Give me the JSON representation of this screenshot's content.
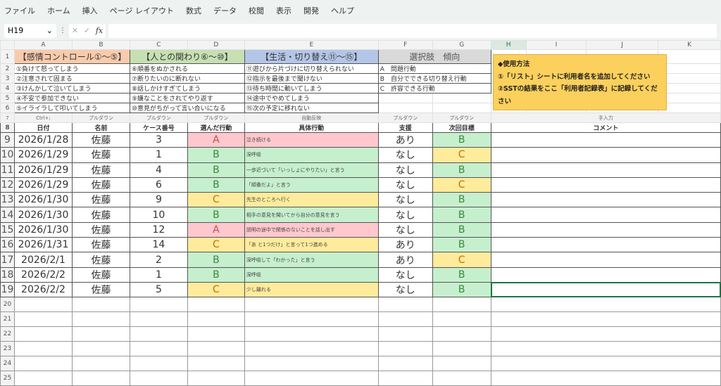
{
  "menu": [
    "ファイル",
    "ホーム",
    "挿入",
    "ページ レイアウト",
    "数式",
    "データ",
    "校閲",
    "表示",
    "開発",
    "ヘルプ"
  ],
  "formula_bar": {
    "name_box": "H19",
    "fx": "fx",
    "value": ""
  },
  "columns": [
    "A",
    "B",
    "C",
    "D",
    "E",
    "F",
    "G",
    "H",
    "I",
    "J",
    "K"
  ],
  "headers": {
    "a": "【感情コントロール①～⑤】",
    "c": "【人との関わり⑥～⑩】",
    "e": "【生活・切り替え⑪～⑮】",
    "f": "選択肢　傾向"
  },
  "list_a": [
    "①負けて怒ってしまう",
    "②注意されて固まる",
    "③けんかして泣いてしまう",
    "④不安で参加できない",
    "⑤イライラして叩いてしまう"
  ],
  "list_c": [
    "⑥順番をぬかされる",
    "⑦断りたいのに断れない",
    "⑧話しかけすぎてしまう",
    "⑨嫌なことをされてやり返す",
    "⑩意見がちがって言い合いになる"
  ],
  "list_e": [
    "⑪遊びから片づけに切り替えられない",
    "⑫指示を最後まで聞けない",
    "⑬待ち時間に動いてしまう",
    "⑭途中でやめてしまう",
    "⑮次の予定に移れない"
  ],
  "list_f": [
    "A　問題行動",
    "B　自分でできる切り替え行動",
    "C　許容できる行動"
  ],
  "row7": {
    "a": "Ctrl+;",
    "b": "プルダウン",
    "c": "プルダウン",
    "d": "プルダウン",
    "e": "自動反映",
    "f": "プルダウン",
    "g": "プルダウン",
    "hk": "手入力"
  },
  "row8": {
    "a": "日付",
    "b": "名前",
    "c": "ケース番号",
    "d": "選んだ行動",
    "e": "具体行動",
    "f": "支援",
    "g": "次回目標",
    "hk": "コメント"
  },
  "records": [
    {
      "date": "2026/1/28",
      "name": "佐藤",
      "case": "3",
      "action": "A",
      "detail": "泣き続ける",
      "support": "あり",
      "goal": "B"
    },
    {
      "date": "2026/1/29",
      "name": "佐藤",
      "case": "1",
      "action": "B",
      "detail": "深呼吸",
      "support": "なし",
      "goal": "C"
    },
    {
      "date": "2026/1/29",
      "name": "佐藤",
      "case": "4",
      "action": "B",
      "detail": "一歩近づいて「いっしょにやりたい」と言う",
      "support": "なし",
      "goal": "B"
    },
    {
      "date": "2026/1/29",
      "name": "佐藤",
      "case": "6",
      "action": "B",
      "detail": "「順番だよ」と言う",
      "support": "なし",
      "goal": "C"
    },
    {
      "date": "2026/1/30",
      "name": "佐藤",
      "case": "9",
      "action": "C",
      "detail": "先生のところへ行く",
      "support": "なし",
      "goal": "B"
    },
    {
      "date": "2026/1/30",
      "name": "佐藤",
      "case": "10",
      "action": "B",
      "detail": "相手の意見を聞いてから自分の意見を言う",
      "support": "なし",
      "goal": "B"
    },
    {
      "date": "2026/1/30",
      "name": "佐藤",
      "case": "12",
      "action": "A",
      "detail": "説明の途中で関係のないことを話し出す",
      "support": "なし",
      "goal": "B"
    },
    {
      "date": "2026/1/31",
      "name": "佐藤",
      "case": "14",
      "action": "C",
      "detail": "「あ と1つだけ」と言って1つ進める",
      "support": "あり",
      "goal": "B"
    },
    {
      "date": "2026/2/1",
      "name": "佐藤",
      "case": "2",
      "action": "B",
      "detail": "深呼吸して「わかった」と言う",
      "support": "あり",
      "goal": "C"
    },
    {
      "date": "2026/2/2",
      "name": "佐藤",
      "case": "1",
      "action": "B",
      "detail": "深呼吸",
      "support": "なし",
      "goal": "B"
    },
    {
      "date": "2026/2/2",
      "name": "佐藤",
      "case": "5",
      "action": "C",
      "detail": "少し離れる",
      "support": "なし",
      "goal": "B"
    }
  ],
  "note": {
    "title": "◆使用方法",
    "line1": "①「リスト」シートに利用者名を追加してください",
    "line2": "②SSTの結果をここ「利用者記録表」に記録してください"
  },
  "colors": {
    "A": "#ffc7ce",
    "B": "#c6efce",
    "C": "#ffeb9c"
  }
}
